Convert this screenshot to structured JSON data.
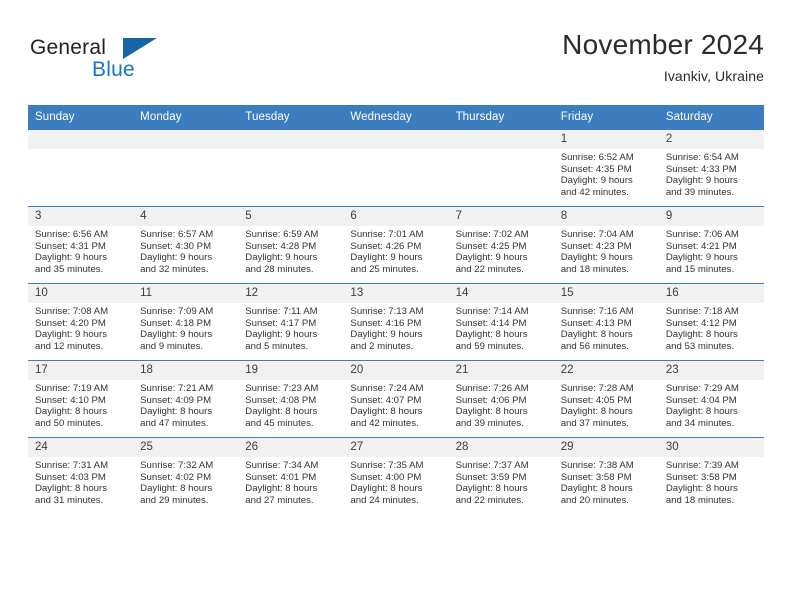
{
  "brand": {
    "name_part1": "General",
    "name_part2": "Blue",
    "accent_color": "#1277c4",
    "triangle_color": "#1565a8"
  },
  "header": {
    "month_title": "November 2024",
    "location": "Ivankiv, Ukraine"
  },
  "calendar": {
    "header_bg": "#3b7dbf",
    "weekdays": [
      "Sunday",
      "Monday",
      "Tuesday",
      "Wednesday",
      "Thursday",
      "Friday",
      "Saturday"
    ],
    "weeks": [
      [
        {
          "day": "",
          "lines": []
        },
        {
          "day": "",
          "lines": []
        },
        {
          "day": "",
          "lines": []
        },
        {
          "day": "",
          "lines": []
        },
        {
          "day": "",
          "lines": []
        },
        {
          "day": "1",
          "lines": [
            "Sunrise: 6:52 AM",
            "Sunset: 4:35 PM",
            "Daylight: 9 hours",
            "and 42 minutes."
          ]
        },
        {
          "day": "2",
          "lines": [
            "Sunrise: 6:54 AM",
            "Sunset: 4:33 PM",
            "Daylight: 9 hours",
            "and 39 minutes."
          ]
        }
      ],
      [
        {
          "day": "3",
          "lines": [
            "Sunrise: 6:56 AM",
            "Sunset: 4:31 PM",
            "Daylight: 9 hours",
            "and 35 minutes."
          ]
        },
        {
          "day": "4",
          "lines": [
            "Sunrise: 6:57 AM",
            "Sunset: 4:30 PM",
            "Daylight: 9 hours",
            "and 32 minutes."
          ]
        },
        {
          "day": "5",
          "lines": [
            "Sunrise: 6:59 AM",
            "Sunset: 4:28 PM",
            "Daylight: 9 hours",
            "and 28 minutes."
          ]
        },
        {
          "day": "6",
          "lines": [
            "Sunrise: 7:01 AM",
            "Sunset: 4:26 PM",
            "Daylight: 9 hours",
            "and 25 minutes."
          ]
        },
        {
          "day": "7",
          "lines": [
            "Sunrise: 7:02 AM",
            "Sunset: 4:25 PM",
            "Daylight: 9 hours",
            "and 22 minutes."
          ]
        },
        {
          "day": "8",
          "lines": [
            "Sunrise: 7:04 AM",
            "Sunset: 4:23 PM",
            "Daylight: 9 hours",
            "and 18 minutes."
          ]
        },
        {
          "day": "9",
          "lines": [
            "Sunrise: 7:06 AM",
            "Sunset: 4:21 PM",
            "Daylight: 9 hours",
            "and 15 minutes."
          ]
        }
      ],
      [
        {
          "day": "10",
          "lines": [
            "Sunrise: 7:08 AM",
            "Sunset: 4:20 PM",
            "Daylight: 9 hours",
            "and 12 minutes."
          ]
        },
        {
          "day": "11",
          "lines": [
            "Sunrise: 7:09 AM",
            "Sunset: 4:18 PM",
            "Daylight: 9 hours",
            "and 9 minutes."
          ]
        },
        {
          "day": "12",
          "lines": [
            "Sunrise: 7:11 AM",
            "Sunset: 4:17 PM",
            "Daylight: 9 hours",
            "and 5 minutes."
          ]
        },
        {
          "day": "13",
          "lines": [
            "Sunrise: 7:13 AM",
            "Sunset: 4:16 PM",
            "Daylight: 9 hours",
            "and 2 minutes."
          ]
        },
        {
          "day": "14",
          "lines": [
            "Sunrise: 7:14 AM",
            "Sunset: 4:14 PM",
            "Daylight: 8 hours",
            "and 59 minutes."
          ]
        },
        {
          "day": "15",
          "lines": [
            "Sunrise: 7:16 AM",
            "Sunset: 4:13 PM",
            "Daylight: 8 hours",
            "and 56 minutes."
          ]
        },
        {
          "day": "16",
          "lines": [
            "Sunrise: 7:18 AM",
            "Sunset: 4:12 PM",
            "Daylight: 8 hours",
            "and 53 minutes."
          ]
        }
      ],
      [
        {
          "day": "17",
          "lines": [
            "Sunrise: 7:19 AM",
            "Sunset: 4:10 PM",
            "Daylight: 8 hours",
            "and 50 minutes."
          ]
        },
        {
          "day": "18",
          "lines": [
            "Sunrise: 7:21 AM",
            "Sunset: 4:09 PM",
            "Daylight: 8 hours",
            "and 47 minutes."
          ]
        },
        {
          "day": "19",
          "lines": [
            "Sunrise: 7:23 AM",
            "Sunset: 4:08 PM",
            "Daylight: 8 hours",
            "and 45 minutes."
          ]
        },
        {
          "day": "20",
          "lines": [
            "Sunrise: 7:24 AM",
            "Sunset: 4:07 PM",
            "Daylight: 8 hours",
            "and 42 minutes."
          ]
        },
        {
          "day": "21",
          "lines": [
            "Sunrise: 7:26 AM",
            "Sunset: 4:06 PM",
            "Daylight: 8 hours",
            "and 39 minutes."
          ]
        },
        {
          "day": "22",
          "lines": [
            "Sunrise: 7:28 AM",
            "Sunset: 4:05 PM",
            "Daylight: 8 hours",
            "and 37 minutes."
          ]
        },
        {
          "day": "23",
          "lines": [
            "Sunrise: 7:29 AM",
            "Sunset: 4:04 PM",
            "Daylight: 8 hours",
            "and 34 minutes."
          ]
        }
      ],
      [
        {
          "day": "24",
          "lines": [
            "Sunrise: 7:31 AM",
            "Sunset: 4:03 PM",
            "Daylight: 8 hours",
            "and 31 minutes."
          ]
        },
        {
          "day": "25",
          "lines": [
            "Sunrise: 7:32 AM",
            "Sunset: 4:02 PM",
            "Daylight: 8 hours",
            "and 29 minutes."
          ]
        },
        {
          "day": "26",
          "lines": [
            "Sunrise: 7:34 AM",
            "Sunset: 4:01 PM",
            "Daylight: 8 hours",
            "and 27 minutes."
          ]
        },
        {
          "day": "27",
          "lines": [
            "Sunrise: 7:35 AM",
            "Sunset: 4:00 PM",
            "Daylight: 8 hours",
            "and 24 minutes."
          ]
        },
        {
          "day": "28",
          "lines": [
            "Sunrise: 7:37 AM",
            "Sunset: 3:59 PM",
            "Daylight: 8 hours",
            "and 22 minutes."
          ]
        },
        {
          "day": "29",
          "lines": [
            "Sunrise: 7:38 AM",
            "Sunset: 3:58 PM",
            "Daylight: 8 hours",
            "and 20 minutes."
          ]
        },
        {
          "day": "30",
          "lines": [
            "Sunrise: 7:39 AM",
            "Sunset: 3:58 PM",
            "Daylight: 8 hours",
            "and 18 minutes."
          ]
        }
      ]
    ]
  }
}
